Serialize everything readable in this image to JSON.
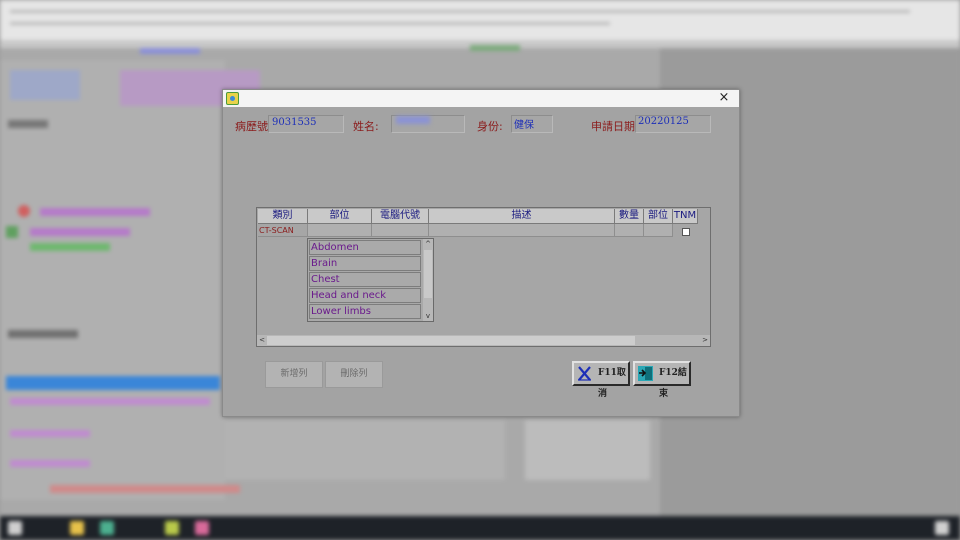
{
  "dialog": {
    "close_glyph": "×",
    "chart_no_label": "病歷號:",
    "chart_no_value": "9031535",
    "name_label": "姓名:",
    "id_label": "身份:",
    "id_value": "健保",
    "date_label": "申請日期:",
    "date_value": "20220125"
  },
  "grid": {
    "headers": [
      "類別",
      "部位",
      "電腦代號",
      "描述",
      "數量",
      "部位",
      "TNM"
    ],
    "row": {
      "category": "CT-SCAN",
      "tnm_checked": false
    }
  },
  "dropdown": {
    "options": [
      "Abdomen",
      "Brain",
      "Chest",
      "Head and neck",
      "Lower limbs"
    ],
    "up_arrow": "^",
    "down_arrow": "v"
  },
  "hscroll": {
    "left_arrow": "<",
    "right_arrow": ">"
  },
  "buttons": {
    "add_row": "新增列",
    "delete_row": "刪除列",
    "cancel": "F11取消",
    "finish": "F12結束"
  },
  "colors": {
    "label_red": "#8b1c1c",
    "value_blue": "#1d2fb8",
    "option_purple": "#6a1a8c"
  }
}
